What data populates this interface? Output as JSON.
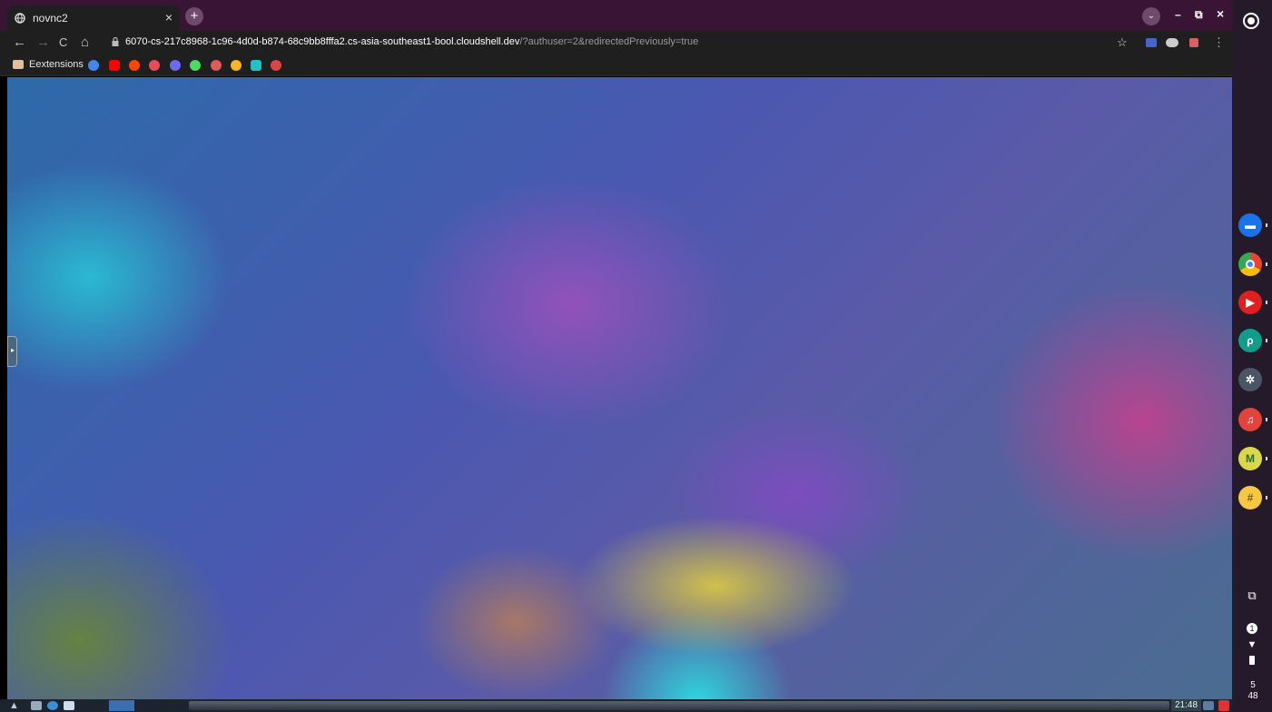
{
  "browser": {
    "tab_title": "novnc2",
    "tab_close": "×",
    "new_tab": "+",
    "url_main": "6070-cs-217c8968-1c96-4d0d-b874-68c9bb8fffa2.cs-asia-southeast1-bool.cloudshell.dev",
    "url_rest": "/?authuser=2&redirectedPreviously=true",
    "nav": {
      "back": "←",
      "forward": "→",
      "reload": "C",
      "home": "⌂"
    },
    "window": {
      "minimize": "–",
      "restore": "⧉",
      "close": "×"
    },
    "bookmark_folder": "Eextensions",
    "star": "☆",
    "menu": "⋮",
    "tab_search": "⌄"
  },
  "bookmarks": [
    {
      "icon": "google-icon",
      "color": "#4285f4"
    },
    {
      "icon": "youtube-icon",
      "color": "#ff0000"
    },
    {
      "icon": "reddit-icon",
      "color": "#ff4500"
    },
    {
      "icon": "pinwheel-icon",
      "color": "#e94b5b"
    },
    {
      "icon": "at-icon",
      "color": "#6a6af4"
    },
    {
      "icon": "pin-icon",
      "color": "#4cd964"
    },
    {
      "icon": "cake-icon",
      "color": "#e05a5a"
    },
    {
      "icon": "bee-icon",
      "color": "#f5b623"
    },
    {
      "icon": "robot-icon",
      "color": "#22c1c3"
    },
    {
      "icon": "globe-icon",
      "color": "#dd4444"
    }
  ],
  "remote": {
    "handle": "▸",
    "clock": "21:48"
  },
  "shelf": {
    "apps": [
      {
        "name": "files-app",
        "color": "#1a73e8",
        "glyph": "▬"
      },
      {
        "name": "chrome-app",
        "color": "#e8453c",
        "glyph": "◉"
      },
      {
        "name": "youtube-music-app",
        "color": "#e02020",
        "glyph": "▶"
      },
      {
        "name": "picsart-app",
        "color": "#0f9d8c",
        "glyph": "ρ"
      },
      {
        "name": "settings-app",
        "color": "#4a5565",
        "glyph": "✲"
      },
      {
        "name": "headphones-app",
        "color": "#e0443a",
        "glyph": "♫"
      },
      {
        "name": "m-app",
        "color": "#d8d84a",
        "glyph": "M"
      },
      {
        "name": "keep-app",
        "color": "#f6c743",
        "glyph": "#"
      }
    ],
    "notification": "1",
    "clock_hour": "5",
    "clock_min": "48"
  }
}
